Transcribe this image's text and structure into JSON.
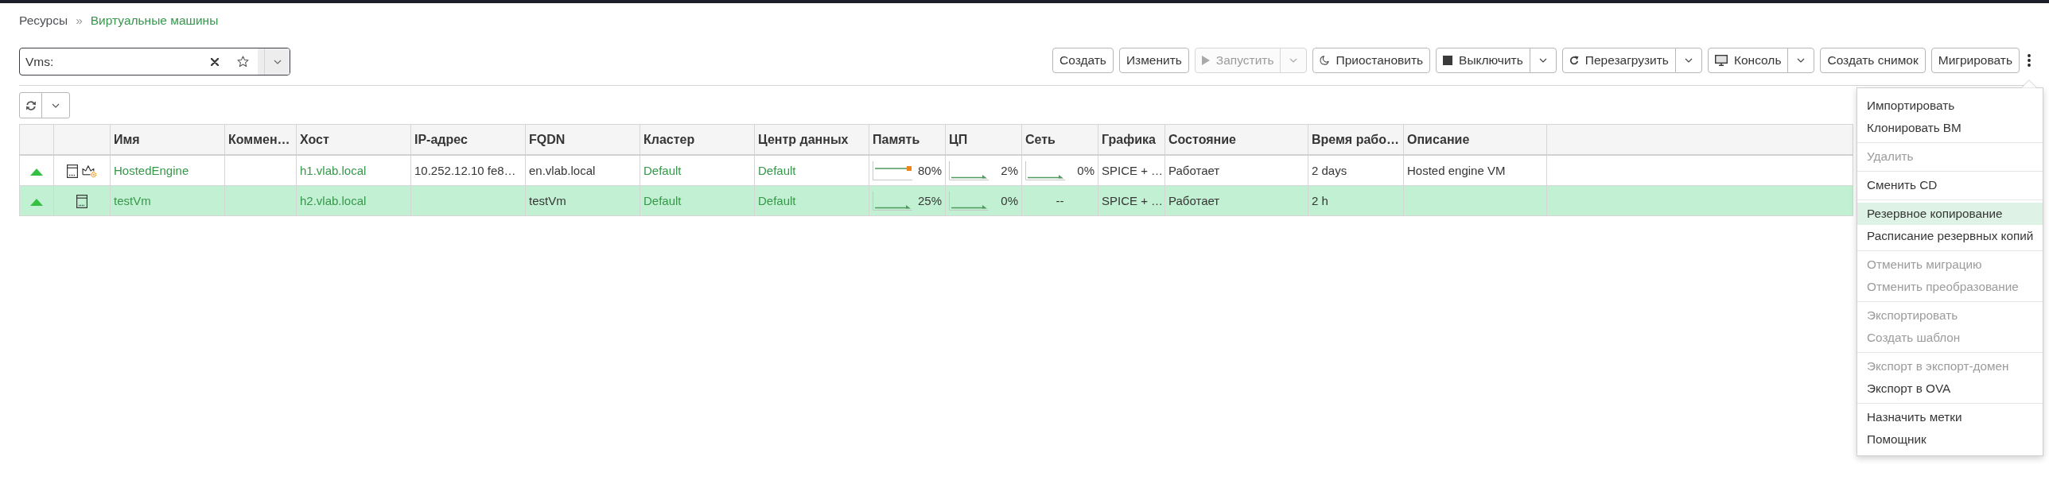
{
  "breadcrumb": {
    "separator": "»",
    "items": [
      {
        "label": "Ресурсы",
        "current": false
      },
      {
        "label": "Виртуальные машины",
        "current": true
      }
    ]
  },
  "search": {
    "label": "Vms:"
  },
  "toolbar": {
    "buttons": [
      {
        "label": "Создать",
        "kind": "plain",
        "disabled": false,
        "dropdown": false
      },
      {
        "label": "Изменить",
        "kind": "plain",
        "disabled": false,
        "dropdown": false
      },
      {
        "label": "Запустить",
        "kind": "start",
        "disabled": true,
        "dropdown": true
      },
      {
        "label": "Приостановить",
        "kind": "suspend",
        "disabled": false,
        "dropdown": false
      },
      {
        "label": "Выключить",
        "kind": "stop",
        "disabled": false,
        "dropdown": true
      },
      {
        "label": "Перезагрузить",
        "kind": "reboot",
        "disabled": false,
        "dropdown": true
      },
      {
        "label": "Консоль",
        "kind": "console",
        "disabled": false,
        "dropdown": true
      },
      {
        "label": "Создать снимок",
        "kind": "plain",
        "disabled": false,
        "dropdown": false
      },
      {
        "label": "Мигрировать",
        "kind": "plain",
        "disabled": false,
        "dropdown": false
      }
    ]
  },
  "table": {
    "columns": [
      {
        "label": "Имя"
      },
      {
        "label": "Коммен…"
      },
      {
        "label": "Хост"
      },
      {
        "label": "IP-адрес"
      },
      {
        "label": "FQDN"
      },
      {
        "label": "Кластер"
      },
      {
        "label": "Центр данных"
      },
      {
        "label": "Память"
      },
      {
        "label": "ЦП"
      },
      {
        "label": "Сеть"
      },
      {
        "label": "Графика"
      },
      {
        "label": "Состояние"
      },
      {
        "label": "Время рабо…"
      },
      {
        "label": "Описание"
      }
    ],
    "rows": [
      {
        "selected": false,
        "running": true,
        "hosted_engine": true,
        "name": "HostedEngine",
        "host": "h1.vlab.local",
        "ip": "10.252.12.10 fe8…",
        "fqdn": "en.vlab.local",
        "cluster": "Default",
        "datacenter": "Default",
        "memory": {
          "text": "80%",
          "sparkline": true,
          "warning": true
        },
        "cpu": {
          "text": "2%",
          "sparkline": true,
          "warning": false
        },
        "network": {
          "text": "0%",
          "sparkline": true,
          "warning": false
        },
        "graphics": "SPICE + …",
        "state": "Работает",
        "uptime": "2 days",
        "description": "Hosted engine VM"
      },
      {
        "selected": true,
        "running": true,
        "hosted_engine": false,
        "name": "testVm",
        "host": "h2.vlab.local",
        "fqdn": "testVm",
        "cluster": "Default",
        "datacenter": "Default",
        "memory": {
          "text": "25%",
          "sparkline": true,
          "warning": false
        },
        "cpu": {
          "text": "0%",
          "sparkline": true,
          "warning": false
        },
        "network": {
          "text": "--",
          "sparkline": false
        },
        "graphics": "SPICE + …",
        "state": "Работает",
        "uptime": "2 h"
      }
    ]
  },
  "actions_menu": {
    "groups": [
      {
        "items": [
          {
            "label": "Импортировать",
            "disabled": false,
            "selected": false
          },
          {
            "label": "Клонировать ВМ",
            "disabled": false,
            "selected": false
          }
        ]
      },
      {
        "items": [
          {
            "label": "Удалить",
            "disabled": true,
            "selected": false
          }
        ]
      },
      {
        "items": [
          {
            "label": "Сменить CD",
            "disabled": false,
            "selected": false
          }
        ]
      },
      {
        "items": [
          {
            "label": "Резервное копирование",
            "disabled": false,
            "selected": true
          },
          {
            "label": "Расписание резервных копий",
            "disabled": false,
            "selected": false
          }
        ]
      },
      {
        "items": [
          {
            "label": "Отменить миграцию",
            "disabled": true,
            "selected": false
          },
          {
            "label": "Отменить преобразование",
            "disabled": true,
            "selected": false
          }
        ]
      },
      {
        "items": [
          {
            "label": "Экспортировать",
            "disabled": true,
            "selected": false
          },
          {
            "label": "Создать шаблон",
            "disabled": true,
            "selected": false
          }
        ]
      },
      {
        "items": [
          {
            "label": "Экспорт в экспорт-домен",
            "disabled": true,
            "selected": false
          },
          {
            "label": "Экспорт в OVA",
            "disabled": false,
            "selected": false
          }
        ]
      },
      {
        "items": [
          {
            "label": "Назначить метки",
            "disabled": false,
            "selected": false
          },
          {
            "label": "Помощник",
            "disabled": false,
            "selected": false
          }
        ]
      }
    ]
  }
}
